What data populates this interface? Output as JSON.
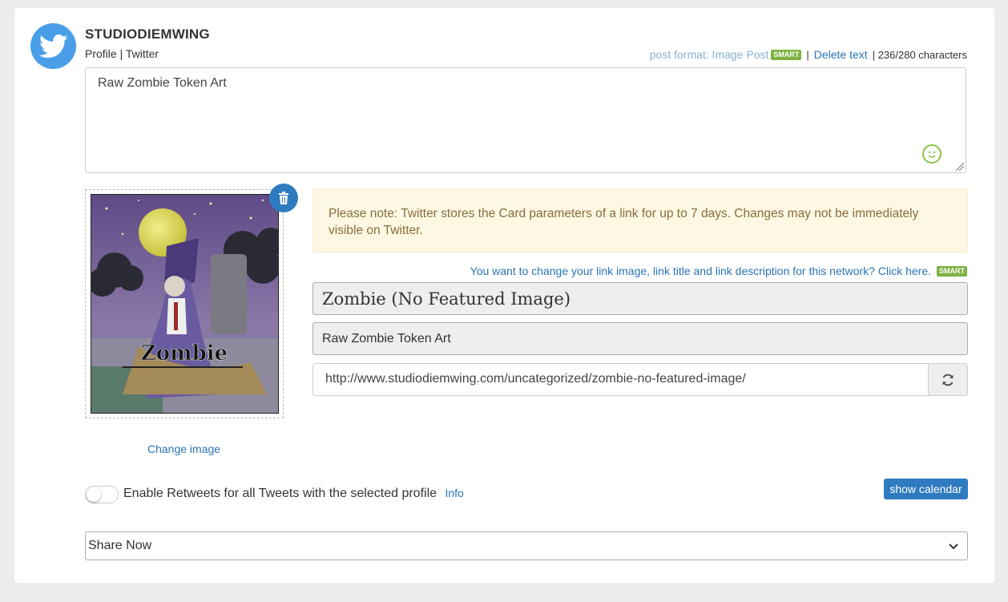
{
  "account": {
    "name": "STUDIODIEMWING",
    "profile_label": "Profile",
    "separator": "|",
    "network": "Twitter"
  },
  "toolbar": {
    "post_format": "post format: Image Post",
    "smart_badge": "SMART",
    "divider": "|",
    "delete_text": "Delete text",
    "char_count": "| 236/280 characters"
  },
  "post": {
    "text": "Raw Zombie Token Art"
  },
  "image": {
    "card_word": "Zombie",
    "change_label": "Change image"
  },
  "note": {
    "text": "Please note: Twitter stores the Card parameters of a link for up to 7 days. Changes may not be immediately visible on Twitter."
  },
  "link_card": {
    "change_prompt": "You want to change your link image, link title and link description for this network? Click here.",
    "smart_badge": "SMART",
    "title": "Zombie (No Featured Image)",
    "description": "Raw Zombie Token Art",
    "url": "http://www.studiodiemwing.com/uncategorized/zombie-no-featured-image/"
  },
  "retweet": {
    "label": "Enable Retweets for all Tweets with the selected profile",
    "info": "Info",
    "enabled": false
  },
  "calendar_button": "show calendar",
  "share": {
    "selected": "Share Now"
  },
  "colors": {
    "accent": "#2f7bc0",
    "twitter": "#4a9ee8",
    "smart": "#7cb342",
    "note_bg": "#fcf8e3"
  }
}
